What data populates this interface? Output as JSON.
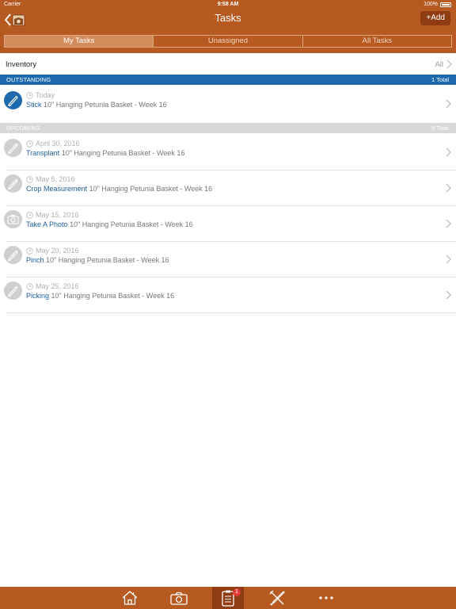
{
  "status_bar": {
    "carrier": "Carrier",
    "time": "9:58 AM",
    "battery": "100%"
  },
  "nav": {
    "title": "Tasks",
    "add_label": "+Add"
  },
  "segments": [
    {
      "label": "My Tasks",
      "active": true
    },
    {
      "label": "Unassigned",
      "active": false
    },
    {
      "label": "All Tasks",
      "active": false
    }
  ],
  "filter": {
    "label": "Inventory",
    "value": "All"
  },
  "outstanding": {
    "title": "OUTSTANDING",
    "total": "1 Total",
    "items": [
      {
        "date": "Today",
        "task": "Stick",
        "detail": "10\" Hanging Petunia Basket - Week 16",
        "icon": "pencil-icon"
      }
    ]
  },
  "upcoming": {
    "title": "UPCOMING",
    "total": "5 Total",
    "items": [
      {
        "date": "April 30, 2016",
        "task": "Transplant",
        "detail": "10\" Hanging Petunia Basket - Week 16",
        "icon": "pencil-icon"
      },
      {
        "date": "May 5, 2016",
        "task": "Crop Measurement",
        "detail": "10\" Hanging Petunia Basket - Week 16",
        "icon": "pencil-icon"
      },
      {
        "date": "May 15, 2016",
        "task": "Take A Photo",
        "detail": "10\" Hanging Petunia Basket - Week 16",
        "icon": "camera-icon"
      },
      {
        "date": "May 20, 2016",
        "task": "Pinch",
        "detail": "10\" Hanging Petunia Basket - Week 16",
        "icon": "pencil-icon"
      },
      {
        "date": "May 25, 2016",
        "task": "Picking",
        "detail": "10\" Hanging Petunia Basket - Week 16",
        "icon": "pencil-icon"
      }
    ]
  },
  "tab_bar": {
    "tabs": [
      {
        "icon": "home-icon"
      },
      {
        "icon": "camera-icon"
      },
      {
        "icon": "clipboard-icon",
        "active": true,
        "badge": "1"
      },
      {
        "icon": "tools-icon"
      },
      {
        "icon": "more-icon"
      }
    ]
  },
  "colors": {
    "brand": "#b65a22",
    "brand_dark": "#8f3c12",
    "outstanding_header": "#1e6aad",
    "upcoming_header": "#d8d8d8",
    "task_link": "#1e5f9e",
    "badge": "#e03b35"
  }
}
